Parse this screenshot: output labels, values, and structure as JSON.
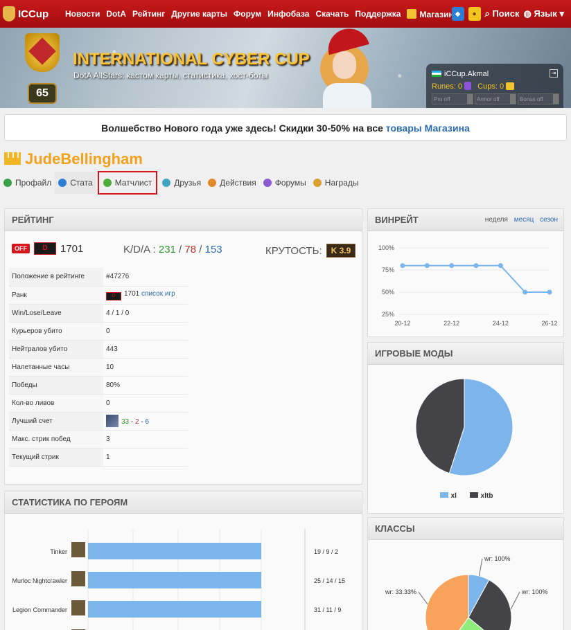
{
  "nav": {
    "logo": "ICCup",
    "links": [
      "Новости",
      "DotA",
      "Рейтинг",
      "Другие карты",
      "Форум",
      "Инфобаза",
      "Скачать",
      "Поддержка",
      "Магазин"
    ],
    "search": "Поиск",
    "language": "Язык"
  },
  "banner": {
    "title": "INTERNATIONAL CYBER CUP",
    "subtitle": "DotA AllStars: кастом карты, статистика, хост-боты",
    "level": "65"
  },
  "user_panel": {
    "name": "iCCup.Akmal",
    "runes_label": "Runes: 0",
    "cups_label": "Cups: 0",
    "slots": [
      "Pro off",
      "Armor off",
      "Bonus off"
    ],
    "messages": "0",
    "warnings": "0"
  },
  "promo": {
    "text": "Волшебство Нового года уже здесь! Скидки 30-50% на все ",
    "link": "товары Магазина"
  },
  "profile": {
    "username": "JudeBellingham",
    "tabs": [
      "Профайл",
      "Стата",
      "Матчлист",
      "Друзья",
      "Действия",
      "Форумы",
      "Награды"
    ]
  },
  "rating": {
    "title": "Рейтинг",
    "status": "OFF",
    "rank_letter": "D",
    "points": "1701",
    "kda_label": "K/D/A :",
    "kills": "231",
    "deaths": "78",
    "assists": "153",
    "cool_label": "КРУТОСТЬ:",
    "cool_value": "K 3.9",
    "rows": [
      {
        "label": "Положение в рейтинге",
        "value": "#47276"
      },
      {
        "label": "Ранк",
        "value": "1701",
        "link": "список игр"
      },
      {
        "label": "Win/Lose/Leave",
        "value": "4 / 1 / 0"
      },
      {
        "label": "Курьеров убито",
        "value": "0"
      },
      {
        "label": "Нейтралов убито",
        "value": "443"
      },
      {
        "label": "Налетанные часы",
        "value": "10"
      },
      {
        "label": "Победы",
        "value": "80%"
      },
      {
        "label": "Кол-во ливов",
        "value": "0"
      },
      {
        "label": "Лучший счет",
        "k": "33",
        "d": "2",
        "a": "6"
      },
      {
        "label": "Макс. стрик побед",
        "value": "3"
      },
      {
        "label": "Текущий стрик",
        "value": "1"
      }
    ]
  },
  "heroes_panel": {
    "title": "Статистика по героям",
    "rows": [
      {
        "name": "Tinker",
        "score": "19 / 9 / 2",
        "fraction": 1.0
      },
      {
        "name": "Murloc Nightcrawler",
        "score": "25 / 14 / 15",
        "fraction": 1.0
      },
      {
        "name": "Legion Commander",
        "score": "31 / 11 / 9",
        "fraction": 1.0
      },
      {
        "name": "",
        "score": "",
        "fraction": 0.5
      }
    ]
  },
  "winrate": {
    "title": "Винрейт",
    "toggles": [
      "неделя",
      "месяц",
      "сезон"
    ],
    "chart_data": {
      "type": "line",
      "x": [
        "20-12",
        "21-12",
        "22-12",
        "23-12",
        "24-12",
        "25-12",
        "26-12"
      ],
      "xticks": [
        "20-12",
        "22-12",
        "24-12",
        "26-12"
      ],
      "values": [
        80,
        80,
        80,
        80,
        80,
        50,
        50
      ],
      "yticks": [
        "100%",
        "75%",
        "50%",
        "25%"
      ],
      "ylim": [
        25,
        100
      ],
      "color": "#7cb5ec"
    }
  },
  "modes": {
    "title": "Игровые моды",
    "chart_data": {
      "type": "pie",
      "labels": [
        "xl",
        "xltb"
      ],
      "values": [
        55,
        45
      ],
      "colors": [
        "#7cb5ec",
        "#434348"
      ]
    }
  },
  "classes": {
    "title": "Классы",
    "chart_data": {
      "type": "pie",
      "labels": [
        "wr: 100%",
        "wr: 100%",
        "wr: 33.33%"
      ],
      "slices": [
        8,
        28,
        24,
        40
      ],
      "colors": [
        "#7cb5ec",
        "#434348",
        "#90ed7d",
        "#f7a35c"
      ]
    }
  }
}
